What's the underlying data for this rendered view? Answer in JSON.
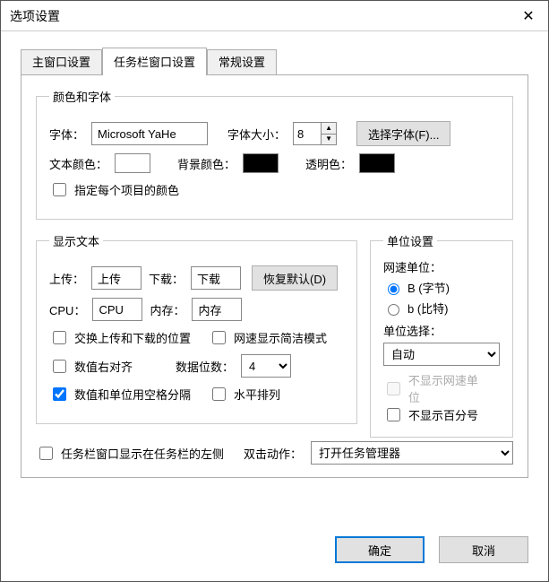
{
  "window": {
    "title": "选项设置"
  },
  "tabs": [
    {
      "label": "主窗口设置"
    },
    {
      "label": "任务栏窗口设置"
    },
    {
      "label": "常规设置"
    }
  ],
  "active_tab": 1,
  "group_font": {
    "legend": "颜色和字体",
    "font_label": "字体：",
    "font_value": "Microsoft YaHe",
    "size_label": "字体大小：",
    "size_value": "8",
    "choose_font_btn": "选择字体(F)...",
    "text_color_label": "文本颜色：",
    "text_color": "#ffffff",
    "bg_color_label": "背景颜色：",
    "bg_color": "#000000",
    "trans_color_label": "透明色：",
    "trans_color": "#000000",
    "per_item_color_label": "指定每个项目的颜色"
  },
  "group_display": {
    "legend": "显示文本",
    "upload_label": "上传：",
    "upload_value": "上传",
    "download_label": "下载：",
    "download_value": "下载",
    "restore_btn": "恢复默认(D)",
    "cpu_label": "CPU：",
    "cpu_value": "CPU",
    "mem_label": "内存：",
    "mem_value": "内存",
    "swap_label": "交换上传和下载的位置",
    "simple_mode_label": "网速显示简洁模式",
    "right_align_label": "数值右对齐",
    "digits_label": "数据位数：",
    "digits_value": "4",
    "space_sep_label": "数值和单位用空格分隔",
    "horizontal_label": "水平排列"
  },
  "group_unit": {
    "legend": "单位设置",
    "speed_unit_label": "网速单位：",
    "byte_label": "B (字节)",
    "bit_label": "b (比特)",
    "unit_select_label": "单位选择：",
    "unit_select_value": "自动",
    "hide_speed_unit_label": "不显示网速单位",
    "hide_percent_label": "不显示百分号"
  },
  "bottom": {
    "left_pos_label": "任务栏窗口显示在任务栏的左侧",
    "dblclick_label": "双击动作：",
    "dblclick_value": "打开任务管理器"
  },
  "footer": {
    "ok": "确定",
    "cancel": "取消"
  }
}
